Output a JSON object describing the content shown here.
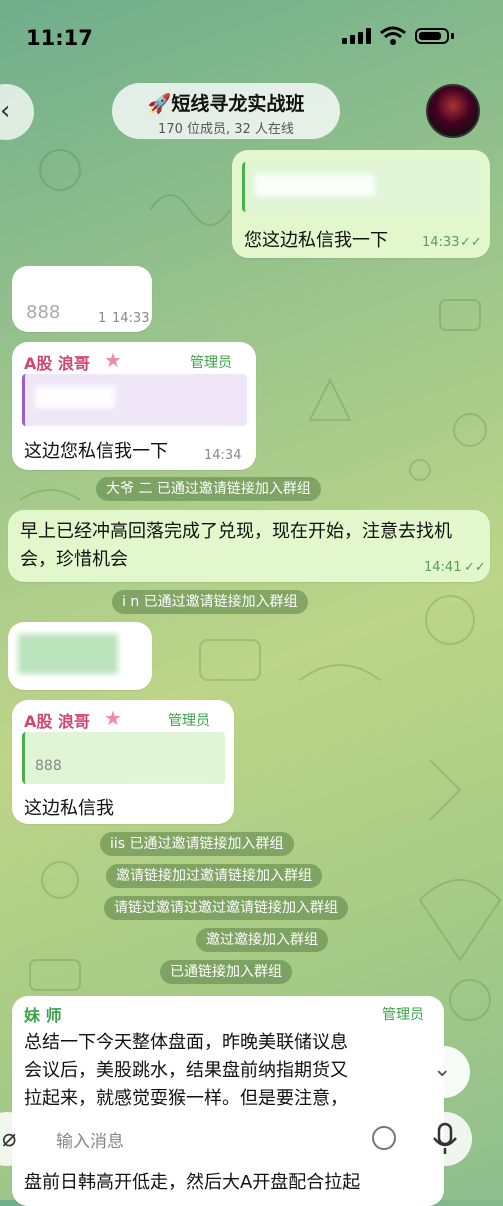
{
  "status_bar": {
    "time": "11:17"
  },
  "header": {
    "back_glyph": "‹",
    "title": "🚀短线寻龙实战班",
    "subtitle": "170 位成员, 32 人在线",
    "avatar_icon": "group-avatar"
  },
  "colors": {
    "accent": "#3ba34a",
    "admin_name": "#d2456e",
    "outgoing_bubble": "#e2f7cb"
  },
  "messages": {
    "m1": {
      "text": "您这边私信我一下",
      "time": "14:33",
      "ticks": "✓✓"
    },
    "m2": {
      "text": "888",
      "views": "1",
      "time": "14:33"
    },
    "m3": {
      "sender": "A股 浪哥",
      "admin": "管理员",
      "text": "这边您私信我一下",
      "time": "14:34"
    },
    "m4": {
      "text": "早上已经冲高回落完成了兑现，现在开始，注意去找机会，珍惜机会",
      "time": "14:41",
      "ticks": "✓✓"
    },
    "m6": {
      "sender": "A股 浪哥",
      "admin": "管理员",
      "reply_text": "888",
      "text": "这边私信我"
    },
    "m7": {
      "sender": "妹 师",
      "admin": "管理员",
      "lines": [
        "总结一下今天整体盘面，昨晚美联储议息",
        "会议后，美股跳水，结果盘前纳指期货又",
        "拉起来，就感觉耍猴一样。但是要注意，",
        "盘前日韩高开低走，然后大A开盘配合拉起"
      ]
    }
  },
  "system": {
    "s1": "大爷 二 已通过邀请链接加入群组",
    "s2": "i n 已通过邀请链接加入群组",
    "s3": "iis 已通过邀请链接加入群组",
    "s4": "邀请链接加过邀请链接加入群组",
    "s5": "请链过邀请过邀过邀请链接加入群组",
    "s6": "邀过邀接加入群组",
    "s7": "已通链接加入群组"
  },
  "composer": {
    "placeholder": "输入消息",
    "scroll_down_glyph": "⌄",
    "attach_glyph": "⌀"
  }
}
